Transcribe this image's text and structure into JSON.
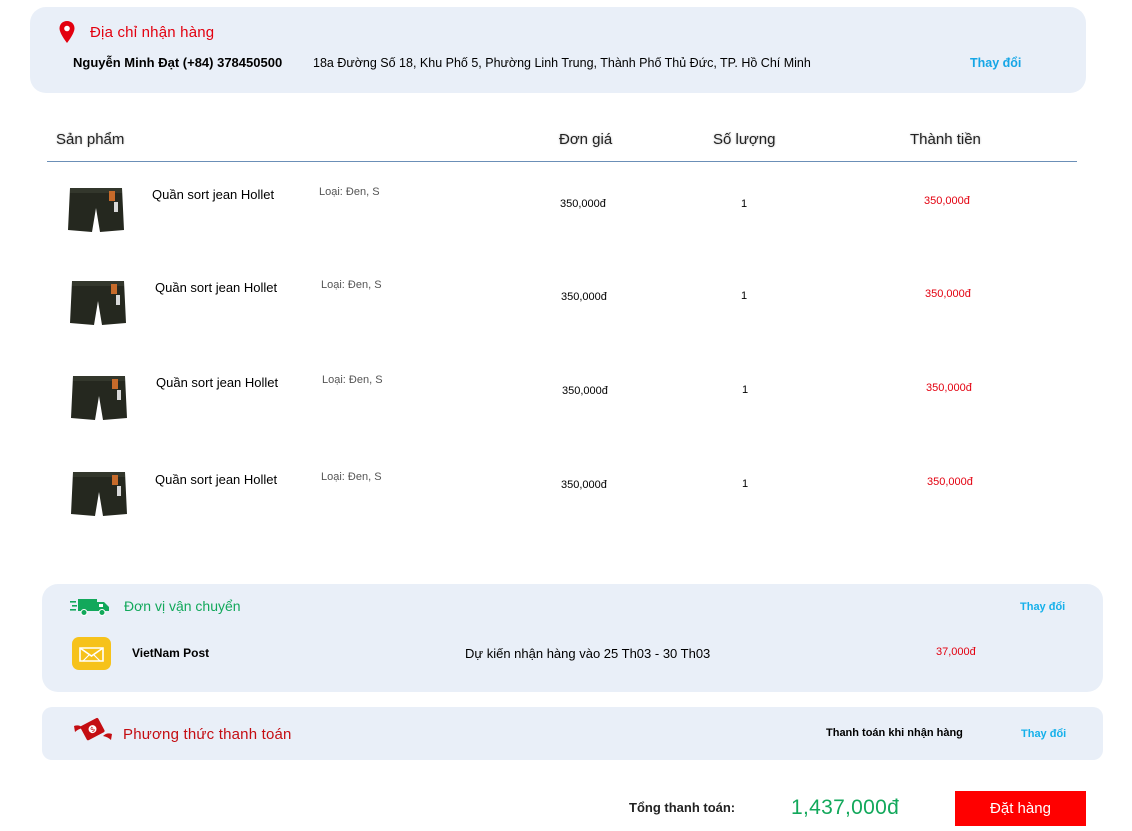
{
  "address": {
    "title": "Địa chỉ nhận hàng",
    "name_phone": "Nguyễn Minh Đạt (+84) 378450500",
    "line": "18a Đường Số 18, Khu Phố 5, Phường Linh Trung, Thành Phố Thủ Đức, TP. Hồ Chí Minh",
    "change_label": "Thay đổi",
    "icon": "location-pin-icon"
  },
  "table": {
    "headers": {
      "product": "Sản phẩm",
      "unit_price": "Đơn giá",
      "quantity": "Số lượng",
      "subtotal": "Thành tiền"
    },
    "rows": [
      {
        "name": "Quần sort jean Hollet",
        "type": "Loại: Đen, S",
        "price": "350,000đ",
        "qty": "1",
        "subtotal": "350,000đ"
      },
      {
        "name": "Quần sort jean Hollet",
        "type": "Loại: Đen, S",
        "price": "350,000đ",
        "qty": "1",
        "subtotal": "350,000đ"
      },
      {
        "name": "Quần sort jean Hollet",
        "type": "Loại: Đen, S",
        "price": "350,000đ",
        "qty": "1",
        "subtotal": "350,000đ"
      },
      {
        "name": "Quần sort jean Hollet",
        "type": "Loại: Đen, S",
        "price": "350,000đ",
        "qty": "1",
        "subtotal": "350,000đ"
      }
    ]
  },
  "shipping": {
    "title": "Đơn vị vận chuyển",
    "change_label": "Thay đổi",
    "carrier": "VietNam Post",
    "eta": "Dự kiến nhận hàng vào 25 Th03 - 30 Th03",
    "fee": "37,000đ",
    "icon": "delivery-truck-icon",
    "carrier_icon": "vietnam-post-logo-icon"
  },
  "payment": {
    "title": "Phương thức thanh toán",
    "method": "Thanh toán khi nhận hàng",
    "change_label": "Thay đổi",
    "icon": "money-wings-icon"
  },
  "footer": {
    "total_label": "Tổng thanh toán:",
    "total_value": "1,437,000đ",
    "order_button": "Đặt hàng"
  },
  "colors": {
    "card_bg": "#e9eff8",
    "accent_red": "#e3000f",
    "accent_green": "#12a85b",
    "link_blue": "#15a6e6",
    "button_red": "#ff0000"
  }
}
